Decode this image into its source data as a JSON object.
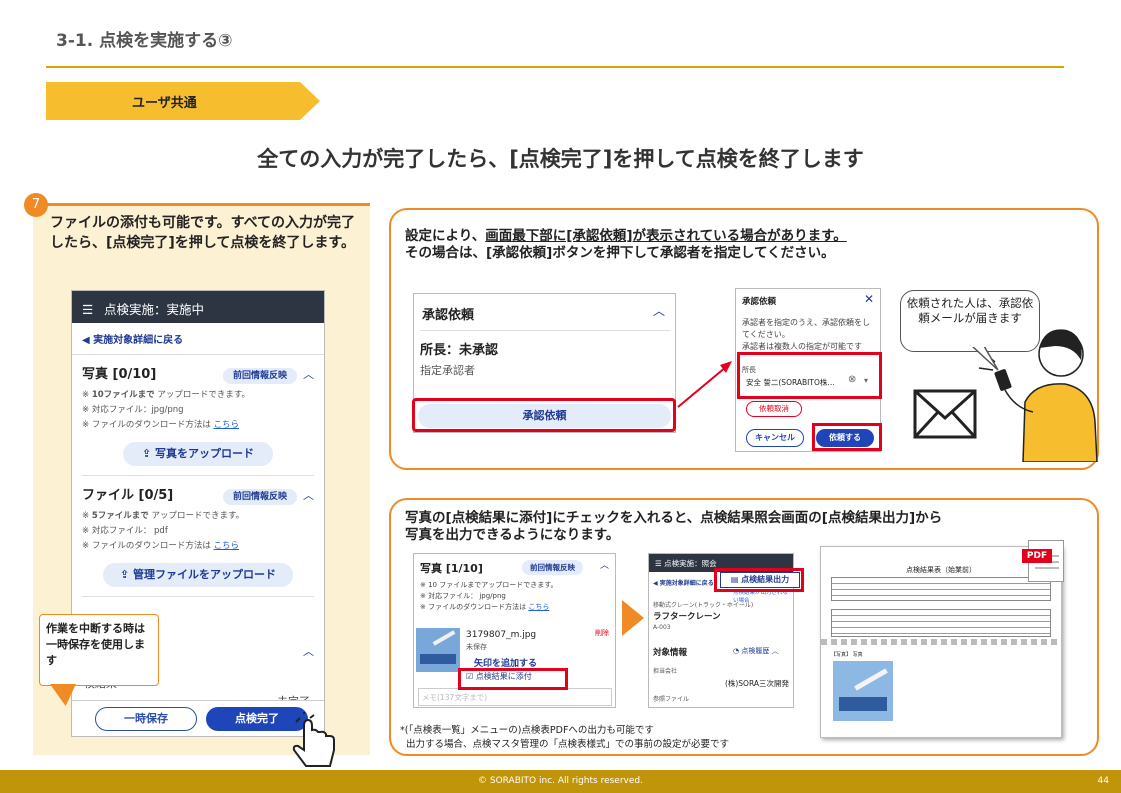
{
  "title": "3-1. 点検を実施する③",
  "tag": "ユーザ共通",
  "headline": "全ての入力が完了したら、[点検完了]を押して点検を終了します",
  "step": {
    "number": "7",
    "text": "ファイルの添付も可能です。すべての入力が完了したら、[点検完了]を押して点検を終了します。"
  },
  "phone": {
    "header": "点検実施：実施中",
    "back": "実施対象詳細に戻る",
    "photo": {
      "title": "写真 [0/10]",
      "pill": "前回情報反映",
      "note1_bold": "10ファイルまで",
      "note1_rest": " アップロードできます。",
      "note2": "※ 対応ファイル：jpg/png",
      "note3": "※ ファイルのダウンロード方法は",
      "link": "こちら",
      "button": "写真をアップロード"
    },
    "file": {
      "title": "ファイル [0/5]",
      "pill": "前回情報反映",
      "note1_bold": "5ファイルまで",
      "note1_rest": " アップロードできます。",
      "note2": "※ 対応ファイル： pdf",
      "note3": "※ ファイルのダウンロード方法は",
      "link": "こちら",
      "button": "管理ファイルをアップロード"
    },
    "partial1": "検結果",
    "partial2": "未完了",
    "save_button": "一時保存",
    "complete_button": "点検完了"
  },
  "callout": "作業を中断する時は一時保存を使用します",
  "panel1": {
    "line1": "設定により、",
    "line1_u": "画面最下部に[承認依頼]が表示されている場合があります。",
    "line2": "その場合は、[承認依頼]ボタンを押下して承認者を指定してください。",
    "card1": {
      "title": "承認依頼",
      "status": "所長：未承認",
      "label": "指定承認者",
      "button": "承認依頼"
    },
    "card2": {
      "title": "承認依頼",
      "desc": "承認者を指定のうえ、承認依頼をしてください。",
      "desc2": "承認者は複数人の指定が可能です",
      "field_label": "所長",
      "field_value": "安全 誓二(SORABITO株…",
      "cancel_request": "依頼取消",
      "cancel": "キャンセル",
      "submit": "依頼する"
    },
    "bubble": "依頼された人は、承認依頼メールが届きます"
  },
  "panel2": {
    "line1": "写真の[点検結果に添付]にチェックを入れると、点検結果照会画面の[点検結果出力]から",
    "line2": "写真を出力できるようになります。",
    "card1": {
      "title": "写真 [1/10]",
      "pill": "前回情報反映",
      "note1": "※ 10 ファイルまでアップロードできます。",
      "note2": "※ 対応ファイル： jpg/png",
      "note3": "※ ファイルのダウンロード方法は",
      "link": "こちら",
      "filename": "3179807_m.jpg",
      "unsaved": "未保存",
      "delete": "削除",
      "add_arrow": "矢印を追加する",
      "checkbox": "点検結果に添付",
      "memo": "メモ(137文字まで)"
    },
    "card2": {
      "header": "点検実施：照会",
      "back": "実施対象詳細に戻る",
      "output_button": "点検結果出力",
      "link_small": "点検結果が出力されない場合",
      "category": "移動式クレーン(トラック・ホイール)",
      "name": "ラフタークレーン",
      "code": "A-003",
      "section": "対象情報",
      "history": "点検履歴",
      "owner_label": "担当会社",
      "owner": "(株)SORA三次開発",
      "files": "参照ファイル"
    },
    "pdf": {
      "badge": "PDF",
      "title": "点検結果表（始業前）",
      "photo_label": "【写真】 写真"
    }
  },
  "footnote1": "*(「点検表一覧」メニューの)点検表PDFへの出力も可能です",
  "footnote2": "出力する場合、点検マスタ管理の「点検表様式」での事前の設定が必要です",
  "footer": "© SORABITO inc. All rights reserved.",
  "page_number": "44",
  "colors": {
    "accent": "#f08a24",
    "gold": "#c0950a",
    "red": "#e3001b",
    "navy": "#1f46b8"
  }
}
